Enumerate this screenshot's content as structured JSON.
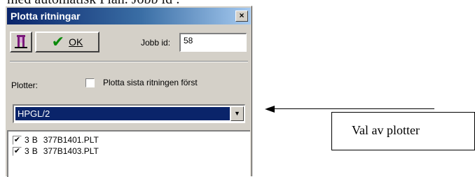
{
  "document": {
    "header_fragment": "med automatisk Plan. Jobb id :"
  },
  "window": {
    "title": "Plotta ritningar",
    "close_glyph": "×"
  },
  "toolbar": {
    "figure_icon": "figure-icon",
    "ok_label": "OK",
    "jobb_label": "Jobb id:",
    "jobb_value": "58"
  },
  "plotter": {
    "label": "Plotter:",
    "first_checkbox_label": "Plotta sista ritningen först",
    "first_checked": false,
    "selected": "HPGL/2",
    "arrow_glyph": "▼"
  },
  "files": [
    {
      "checked": true,
      "check_glyph": "✔",
      "col1": "3",
      "col2": "B",
      "name": "377B1401.PLT"
    },
    {
      "checked": true,
      "check_glyph": "✔",
      "col1": "3",
      "col2": "B",
      "name": "377B1403.PLT"
    }
  ],
  "annotation": {
    "callout_text": "Val av plotter"
  }
}
